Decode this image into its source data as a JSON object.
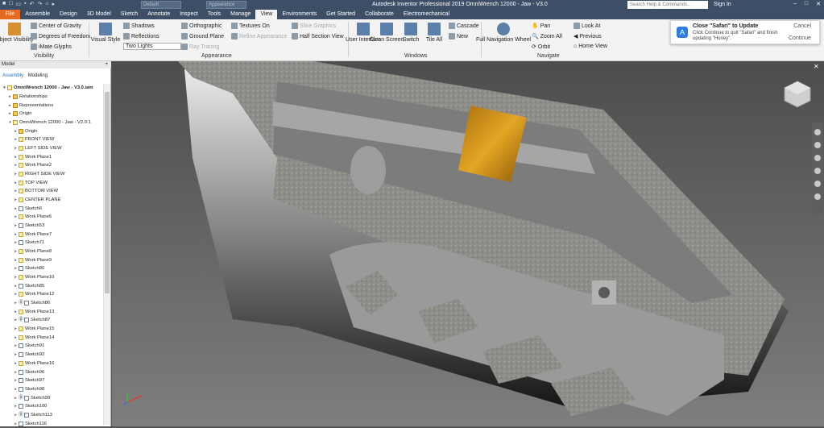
{
  "title_bar": {
    "title": "Autodesk Inventor Professional 2019    OmniWrench 12000 - Jaw - V3.0",
    "material_field": "Default",
    "appearance_field": "Appearance",
    "search_placeholder": "Search Help & Commands...",
    "sign_in": "Sign In"
  },
  "menu_tabs": [
    "File",
    "Assemble",
    "Design",
    "3D Model",
    "Sketch",
    "Annotate",
    "Inspect",
    "Tools",
    "Manage",
    "View",
    "Environments",
    "Get Started",
    "Collaborate",
    "Electromechanical"
  ],
  "active_tab": "View",
  "ribbon": {
    "visibility": {
      "object_visibility": "Object Visibility",
      "center_of_gravity": "Center of Gravity",
      "degrees_of_freedom": "Degrees of Freedom",
      "imate_glyphs": "iMate Glyphs",
      "panel_label": "Visibility"
    },
    "appearance": {
      "visual_style": "Visual Style",
      "shadows": "Shadows",
      "reflections": "Reflections",
      "lighting": "Two Lights",
      "orthographic": "Orthographic",
      "ground_plane": "Ground Plane",
      "ray_tracing": "Ray Tracing",
      "textures_on": "Textures On",
      "refine_appearance": "Refine Appearance",
      "slice_graphics": "Slice Graphics",
      "half_section_view": "Half Section View",
      "panel_label": "Appearance"
    },
    "windows": {
      "user_interface": "User Interface",
      "clean_screen": "Clean Screen",
      "switch": "Switch",
      "tile_all": "Tile All",
      "cascade": "Cascade",
      "new": "New",
      "panel_label": "Windows"
    },
    "navigate": {
      "full_navigation_wheel": "Full Navigation Wheel",
      "pan": "Pan",
      "zoom_all": "Zoom All",
      "orbit": "Orbit",
      "look_at": "Look At",
      "previous": "Previous",
      "home_view": "Home View",
      "panel_label": "Navigate"
    }
  },
  "notification": {
    "title": "Close \"Safari\" to Update",
    "body": "Click Continue to quit \"Safari\" and finish updating \"Honey\".",
    "cancel": "Cancel",
    "continue": "Continue"
  },
  "browser": {
    "header": "Model",
    "tabs": [
      "Assembly",
      "Modeling"
    ],
    "active_tab": "Assembly",
    "nodes": [
      {
        "label": "OmniWrench 12000 - Jaw - V3.0.iam",
        "icon": "assembly-icon",
        "indent": 0,
        "expanded": true,
        "bold": true
      },
      {
        "label": "Relationships",
        "icon": "folder-icon",
        "indent": 1
      },
      {
        "label": "Representations",
        "icon": "folder-icon",
        "indent": 1
      },
      {
        "label": "Origin",
        "icon": "folder-icon",
        "indent": 1
      },
      {
        "label": "OmniWrench 12000 - Jaw - V2.0:1",
        "icon": "part-icon",
        "indent": 1,
        "expanded": true
      },
      {
        "label": "Origin",
        "icon": "folder-icon",
        "indent": 2
      },
      {
        "label": "FRONT VIEW",
        "icon": "view-icon",
        "indent": 2
      },
      {
        "label": "LEFT SIDE VIEW",
        "icon": "view-icon",
        "indent": 2
      },
      {
        "label": "Work Plane1",
        "icon": "workplane-icon",
        "indent": 2
      },
      {
        "label": "Work Plane2",
        "icon": "workplane-icon",
        "indent": 2
      },
      {
        "label": "RIGHT SIDE VIEW",
        "icon": "view-icon",
        "indent": 2
      },
      {
        "label": "TOP VIEW",
        "icon": "view-icon",
        "indent": 2
      },
      {
        "label": "BOTTOM VIEW",
        "icon": "view-icon",
        "indent": 2
      },
      {
        "label": "CENTER PLANE",
        "icon": "workplane-icon",
        "indent": 2
      },
      {
        "label": "Sketch6",
        "icon": "sketch-icon",
        "indent": 2
      },
      {
        "label": "Work Plane6",
        "icon": "workplane-icon",
        "indent": 2
      },
      {
        "label": "Sketch53",
        "icon": "sketch-icon",
        "indent": 2
      },
      {
        "label": "Work Plane7",
        "icon": "workplane-icon",
        "indent": 2
      },
      {
        "label": "Sketch71",
        "icon": "sketch-icon",
        "indent": 2
      },
      {
        "label": "Work Plane8",
        "icon": "workplane-icon",
        "indent": 2
      },
      {
        "label": "Work Plane9",
        "icon": "workplane-icon",
        "indent": 2
      },
      {
        "label": "Sketch80",
        "icon": "sketch-icon",
        "indent": 2
      },
      {
        "label": "Work Plane10",
        "icon": "workplane-icon",
        "indent": 2
      },
      {
        "label": "Sketch85",
        "icon": "sketch-icon",
        "indent": 2
      },
      {
        "label": "Work Plane12",
        "icon": "workplane-icon",
        "indent": 2
      },
      {
        "label": "Sketch86",
        "icon": "sketch-icon",
        "indent": 2,
        "warning": true
      },
      {
        "label": "Work Plane13",
        "icon": "workplane-icon",
        "indent": 2
      },
      {
        "label": "Sketch87",
        "icon": "sketch-icon",
        "indent": 2,
        "warning": true
      },
      {
        "label": "Work Plane15",
        "icon": "workplane-icon",
        "indent": 2
      },
      {
        "label": "Work Plane14",
        "icon": "workplane-icon",
        "indent": 2
      },
      {
        "label": "Sketch91",
        "icon": "sketch-icon",
        "indent": 2
      },
      {
        "label": "Sketch92",
        "icon": "sketch-icon",
        "indent": 2
      },
      {
        "label": "Work Plane16",
        "icon": "workplane-icon",
        "indent": 2
      },
      {
        "label": "Sketch96",
        "icon": "sketch-icon",
        "indent": 2
      },
      {
        "label": "Sketch97",
        "icon": "sketch-icon",
        "indent": 2
      },
      {
        "label": "Sketch98",
        "icon": "sketch-icon",
        "indent": 2
      },
      {
        "label": "Sketch99",
        "icon": "sketch-icon",
        "indent": 2,
        "warning": true
      },
      {
        "label": "Sketch100",
        "icon": "sketch-icon",
        "indent": 2
      },
      {
        "label": "Sketch113",
        "icon": "sketch-icon",
        "indent": 2,
        "warning": true
      },
      {
        "label": "Sketch116",
        "icon": "sketch-icon",
        "indent": 2
      }
    ]
  },
  "colors": {
    "title_bar": "#3d4f66",
    "file_tab": "#e46b21",
    "ribbon": "#f3f3f3",
    "viewport_top": "#4d4d4d",
    "viewport_bottom": "#7e7e7e",
    "highlight_face": "#d89a1c"
  }
}
